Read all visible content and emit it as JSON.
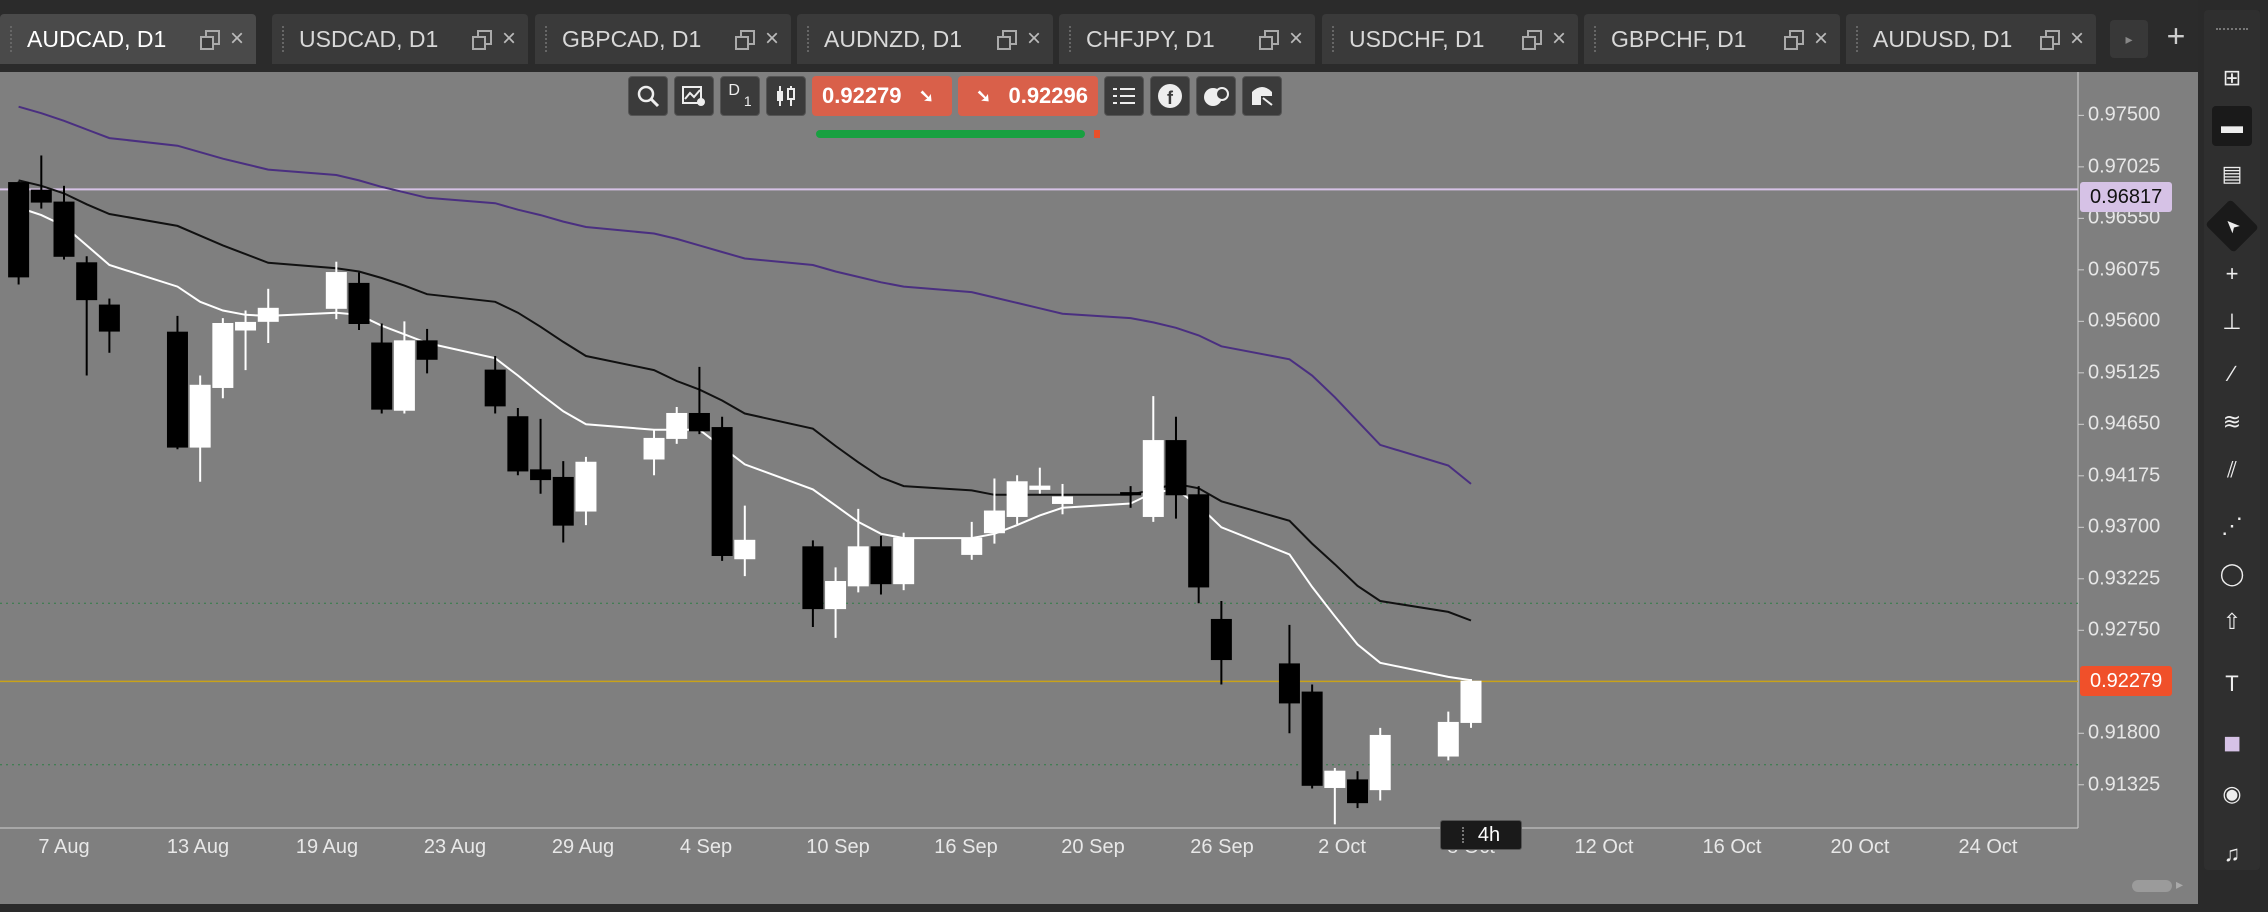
{
  "tabs": [
    {
      "label": "AUDCAD, D1",
      "active": true
    },
    {
      "label": "USDCAD, D1",
      "active": false
    },
    {
      "label": "GBPCAD, D1",
      "active": false
    },
    {
      "label": "AUDNZD, D1",
      "active": false
    },
    {
      "label": "CHFJPY, D1",
      "active": false
    },
    {
      "label": "USDCHF, D1",
      "active": false
    },
    {
      "label": "GBPCHF, D1",
      "active": false
    },
    {
      "label": "AUDUSD, D1",
      "active": false
    }
  ],
  "tab_add": "+",
  "toolbar": {
    "timeframe": "D",
    "timeframe_sub": "1",
    "sell_price": "0.92279",
    "buy_price": "0.92296",
    "spread_fill": 0.96
  },
  "price_axis": [
    "0.97500",
    "0.97025",
    "0.96550",
    "0.96075",
    "0.95600",
    "0.95125",
    "0.94650",
    "0.94175",
    "0.93700",
    "0.93225",
    "0.92750",
    "0.91800",
    "0.91325"
  ],
  "date_axis": [
    "7 Aug",
    "13 Aug",
    "19 Aug",
    "23 Aug",
    "29 Aug",
    "4 Sep",
    "10 Sep",
    "16 Sep",
    "20 Sep",
    "26 Sep",
    "2 Oct",
    "8 Oct",
    "12 Oct",
    "16 Oct",
    "20 Oct",
    "24 Oct"
  ],
  "horizontal_line_price": "0.96817",
  "current_price_badge": "0.92279",
  "timeframe_tooltip": "4h",
  "right_tools": [
    "layout-grid-icon",
    "single-window-icon",
    "split-window-icon",
    "cursor-icon",
    "crosshair-icon",
    "measure-icon",
    "trendline-icon",
    "fibonacci-icon",
    "pitchfork-icon",
    "gann-icon",
    "ellipse-icon",
    "arrow-up-icon",
    "text-icon",
    "color-swatch-icon",
    "camera-icon",
    "alarm-icon"
  ],
  "colors": {
    "chart_bg": "#7f7f7f",
    "bull": "#ffffff",
    "bear": "#000000",
    "ma_fast": "#ffffff",
    "ma_slow": "#111111",
    "ma_long": "#4a2f80",
    "level_line": "#d6c2e6",
    "price_line": "#c9a21a",
    "accent_price": "#f0502a"
  },
  "chart_data": {
    "type": "candlestick",
    "symbol": "AUDCAD",
    "timeframe": "D1",
    "ylim": [
      0.91,
      0.979
    ],
    "x": [
      "2024-08-05",
      "2024-08-06",
      "2024-08-07",
      "2024-08-08",
      "2024-08-09",
      "2024-08-12",
      "2024-08-13",
      "2024-08-14",
      "2024-08-15",
      "2024-08-16",
      "2024-08-19",
      "2024-08-20",
      "2024-08-21",
      "2024-08-22",
      "2024-08-23",
      "2024-08-26",
      "2024-08-27",
      "2024-08-28",
      "2024-08-29",
      "2024-08-30",
      "2024-09-02",
      "2024-09-03",
      "2024-09-04",
      "2024-09-05",
      "2024-09-06",
      "2024-09-09",
      "2024-09-10",
      "2024-09-11",
      "2024-09-12",
      "2024-09-13",
      "2024-09-16",
      "2024-09-17",
      "2024-09-18",
      "2024-09-19",
      "2024-09-20",
      "2024-09-23",
      "2024-09-24",
      "2024-09-25",
      "2024-09-26",
      "2024-09-27",
      "2024-09-30",
      "2024-10-01",
      "2024-10-02",
      "2024-10-03",
      "2024-10-04",
      "2024-10-07",
      "2024-10-08"
    ],
    "ohlc": [
      [
        0.9688,
        0.9689,
        0.9594,
        0.9601
      ],
      [
        0.9681,
        0.9713,
        0.9664,
        0.967
      ],
      [
        0.967,
        0.9685,
        0.9617,
        0.962
      ],
      [
        0.9614,
        0.962,
        0.951,
        0.958
      ],
      [
        0.9575,
        0.9581,
        0.9531,
        0.9551
      ],
      [
        0.955,
        0.9565,
        0.9442,
        0.9444
      ],
      [
        0.9444,
        0.951,
        0.9412,
        0.9501
      ],
      [
        0.9499,
        0.9563,
        0.9489,
        0.9558
      ],
      [
        0.9552,
        0.957,
        0.9515,
        0.9559
      ],
      [
        0.956,
        0.959,
        0.954,
        0.9572
      ],
      [
        0.9572,
        0.9615,
        0.9562,
        0.9605
      ],
      [
        0.9595,
        0.9605,
        0.9552,
        0.9558
      ],
      [
        0.954,
        0.9558,
        0.9475,
        0.9479
      ],
      [
        0.9478,
        0.956,
        0.9475,
        0.9542
      ],
      [
        0.9542,
        0.9553,
        0.9512,
        0.9525
      ],
      [
        0.9515,
        0.9528,
        0.9475,
        0.9482
      ],
      [
        0.9472,
        0.948,
        0.9418,
        0.9422
      ],
      [
        0.9423,
        0.947,
        0.9401,
        0.9414
      ],
      [
        0.9416,
        0.9431,
        0.9356,
        0.9372
      ],
      [
        0.9385,
        0.9435,
        0.9372,
        0.943
      ],
      [
        0.9433,
        0.946,
        0.9418,
        0.9452
      ],
      [
        0.9452,
        0.9481,
        0.9447,
        0.9475
      ],
      [
        0.9475,
        0.9518,
        0.9456,
        0.9459
      ],
      [
        0.9462,
        0.9472,
        0.9339,
        0.9344
      ],
      [
        0.9341,
        0.939,
        0.9325,
        0.9358
      ],
      [
        0.9352,
        0.9358,
        0.9278,
        0.9295
      ],
      [
        0.9295,
        0.9333,
        0.9268,
        0.932
      ],
      [
        0.9316,
        0.9387,
        0.931,
        0.9352
      ],
      [
        0.9352,
        0.9362,
        0.9308,
        0.9318
      ],
      [
        0.9318,
        0.9365,
        0.9312,
        0.936
      ],
      [
        0.9345,
        0.9375,
        0.934,
        0.936
      ],
      [
        0.9365,
        0.9415,
        0.9355,
        0.9385
      ],
      [
        0.938,
        0.9418,
        0.9373,
        0.9412
      ],
      [
        0.9405,
        0.9425,
        0.9401,
        0.9408
      ],
      [
        0.9392,
        0.941,
        0.9382,
        0.9398
      ],
      [
        0.9402,
        0.9408,
        0.9388,
        0.94
      ],
      [
        0.938,
        0.9491,
        0.9375,
        0.945
      ],
      [
        0.945,
        0.9472,
        0.9378,
        0.94
      ],
      [
        0.94,
        0.9408,
        0.93,
        0.9315
      ],
      [
        0.9285,
        0.9302,
        0.9225,
        0.9248
      ],
      [
        0.9244,
        0.928,
        0.918,
        0.9208
      ],
      [
        0.9218,
        0.9225,
        0.9129,
        0.9132
      ],
      [
        0.913,
        0.9148,
        0.9096,
        0.9145
      ],
      [
        0.9137,
        0.9145,
        0.9111,
        0.9116
      ],
      [
        0.9128,
        0.9185,
        0.9118,
        0.9178
      ],
      [
        0.9159,
        0.92,
        0.9155,
        0.919
      ],
      [
        0.919,
        0.923,
        0.9185,
        0.9228
      ]
    ],
    "ma_fast": [
      0.9665,
      0.9658,
      0.9648,
      0.963,
      0.9612,
      0.9592,
      0.9578,
      0.957,
      0.9566,
      0.9565,
      0.9568,
      0.9566,
      0.9556,
      0.9548,
      0.954,
      0.9526,
      0.951,
      0.9493,
      0.9477,
      0.9465,
      0.946,
      0.946,
      0.946,
      0.9444,
      0.9428,
      0.9405,
      0.939,
      0.9375,
      0.9364,
      0.936,
      0.936,
      0.9364,
      0.9372,
      0.9381,
      0.9388,
      0.9392,
      0.9402,
      0.9405,
      0.939,
      0.937,
      0.9345,
      0.9315,
      0.9288,
      0.9262,
      0.9245,
      0.9232,
      0.9229
    ],
    "ma_slow": [
      0.969,
      0.9685,
      0.9678,
      0.9668,
      0.9659,
      0.9648,
      0.9639,
      0.963,
      0.9622,
      0.9614,
      0.9609,
      0.9606,
      0.96,
      0.9593,
      0.9585,
      0.9578,
      0.9568,
      0.9555,
      0.9541,
      0.9528,
      0.9515,
      0.9505,
      0.9497,
      0.9487,
      0.9475,
      0.9461,
      0.9445,
      0.943,
      0.9416,
      0.9408,
      0.9404,
      0.94,
      0.94,
      0.94,
      0.94,
      0.94,
      0.9405,
      0.941,
      0.9406,
      0.9394,
      0.9376,
      0.9355,
      0.9336,
      0.9316,
      0.9302,
      0.9292,
      0.9284
    ],
    "ma_long": [
      0.9758,
      0.9752,
      0.9745,
      0.9737,
      0.9729,
      0.9722,
      0.9716,
      0.971,
      0.9705,
      0.97,
      0.9695,
      0.969,
      0.9684,
      0.9679,
      0.9674,
      0.9669,
      0.9663,
      0.9658,
      0.9652,
      0.9647,
      0.9641,
      0.9636,
      0.963,
      0.9624,
      0.9618,
      0.9612,
      0.9606,
      0.9601,
      0.9596,
      0.9592,
      0.9587,
      0.9582,
      0.9577,
      0.9572,
      0.9567,
      0.9563,
      0.9559,
      0.9554,
      0.9547,
      0.9537,
      0.9525,
      0.951,
      0.949,
      0.9468,
      0.9446,
      0.9427,
      0.941
    ],
    "horizontal_line": 0.96817,
    "bid": 0.92279,
    "dotted_levels": [
      0.93,
      0.9151
    ]
  }
}
